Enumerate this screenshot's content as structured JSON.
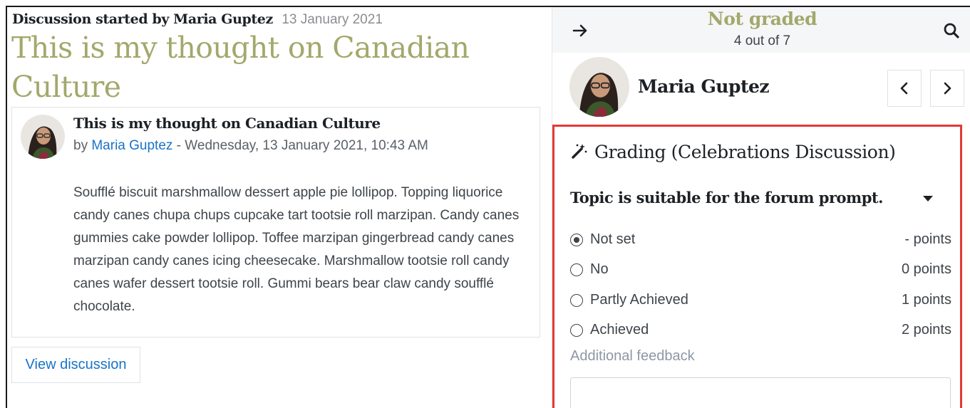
{
  "discussion": {
    "started_by": "Discussion started by Maria Guptez",
    "started_date": "13 January 2021",
    "title": "This is my thought on Canadian Culture"
  },
  "post": {
    "title": "This is my thought on Canadian Culture",
    "by": "by ",
    "author": "Maria Guptez",
    "datetime": " - Wednesday, 13 January 2021, 10:43 AM",
    "body": "Soufflé biscuit marshmallow dessert apple pie lollipop. Topping liquorice candy canes chupa chups cupcake tart tootsie roll marzipan. Candy canes gummies cake powder lollipop. Toffee marzipan gingerbread candy canes marzipan candy canes icing cheesecake. Marshmallow tootsie roll candy canes wafer dessert tootsie roll. Gummi bears bear claw candy soufflé chocolate."
  },
  "view_discussion_label": "View discussion",
  "grader": {
    "status": "Not graded",
    "count": "4 out of 7",
    "user_name": "Maria Guptez",
    "grading_title": "Grading (Celebrations Discussion)",
    "criterion": "Topic is suitable for the forum prompt.",
    "options": [
      {
        "label": "Not set",
        "points": "- points",
        "selected": true
      },
      {
        "label": "No",
        "points": "0 points",
        "selected": false
      },
      {
        "label": "Partly Achieved",
        "points": "1 points",
        "selected": false
      },
      {
        "label": "Achieved",
        "points": "2 points",
        "selected": false
      }
    ],
    "feedback_label": "Additional feedback",
    "feedback_value": ""
  },
  "icons": {
    "collapse": "arrow-right-icon",
    "search": "search-icon",
    "prev": "chevron-left-icon",
    "next": "chevron-right-icon",
    "grading": "magic-wand-icon",
    "criterion_toggle": "caret-down-icon"
  },
  "colors": {
    "title_accent": "#a3a86c",
    "link": "#1a73c8",
    "highlight_border": "#e53935"
  }
}
